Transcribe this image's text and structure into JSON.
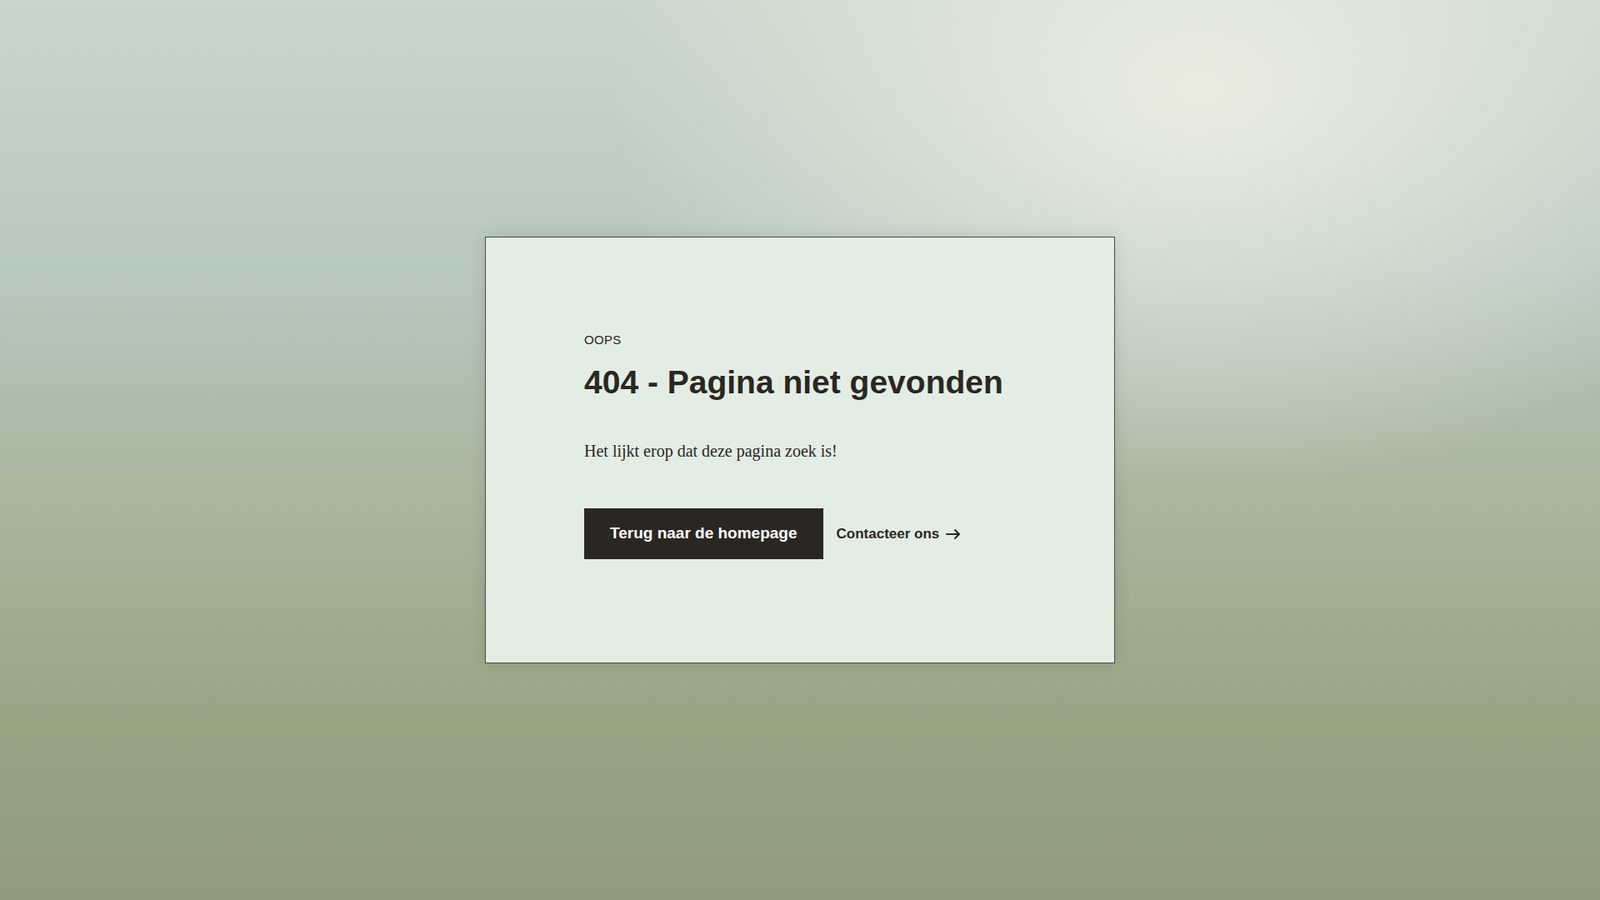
{
  "label": "OOPS",
  "heading": "404 - Pagina niet gevonden",
  "message": "Het lijkt erop dat deze pagina zoek is!",
  "buttons": [
    {
      "label": "Terug naar de homepage"
    },
    {
      "label": "Contacteer ons"
    }
  ]
}
